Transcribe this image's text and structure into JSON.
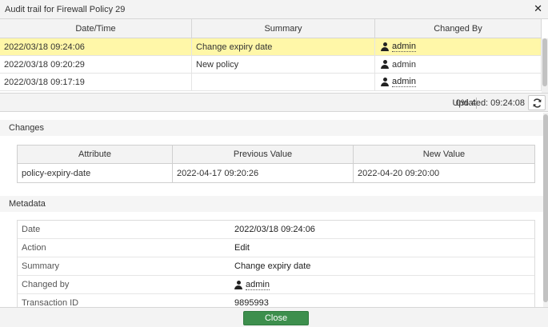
{
  "dialog": {
    "title": "Audit trail for Firewall Policy 29"
  },
  "audit": {
    "columns": [
      "Date/Time",
      "Summary",
      "Changed By"
    ],
    "rows": [
      {
        "datetime": "2022/03/18 09:24:06",
        "summary": "Change expiry date",
        "user": "admin"
      },
      {
        "datetime": "2022/03/18 09:20:29",
        "summary": "New policy",
        "user": "admin"
      },
      {
        "datetime": "2022/03/18 09:17:19",
        "summary": "",
        "user": "admin"
      }
    ]
  },
  "status": {
    "progress": "0%",
    "count": "4",
    "updated": "Updated: 09:24:08"
  },
  "changes": {
    "title": "Changes",
    "columns": [
      "Attribute",
      "Previous Value",
      "New Value"
    ],
    "rows": [
      {
        "attribute": "policy-expiry-date",
        "previous": "2022-04-17 09:20:26",
        "new": "2022-04-20 09:20:00"
      }
    ]
  },
  "metadata": {
    "title": "Metadata",
    "rows": [
      {
        "key": "Date",
        "value": "2022/03/18 09:24:06"
      },
      {
        "key": "Action",
        "value": "Edit"
      },
      {
        "key": "Summary",
        "value": "Change expiry date"
      },
      {
        "key": "Changed by",
        "value": "admin"
      },
      {
        "key": "Transaction ID",
        "value": "9895993"
      }
    ]
  },
  "footer": {
    "close_label": "Close"
  },
  "colors": {
    "selected_row": "#fff7a8",
    "close_button": "#3d8f4d"
  }
}
